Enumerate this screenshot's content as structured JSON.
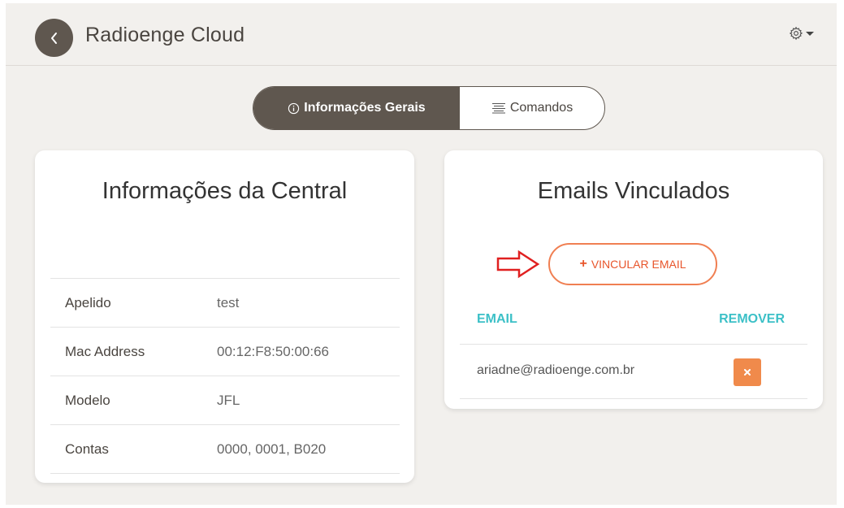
{
  "header": {
    "title": "Radioenge Cloud",
    "back_icon": "chevron-left-icon",
    "settings_icon": "gear-icon"
  },
  "tabs": [
    {
      "label": "Informações Gerais",
      "icon": "info-icon",
      "active": true
    },
    {
      "label": "Comandos",
      "icon": "list-icon",
      "active": false
    }
  ],
  "info_card": {
    "title": "Informações da Central",
    "rows": [
      {
        "label": "Apelido",
        "value": "test"
      },
      {
        "label": "Mac Address",
        "value": "00:12:F8:50:00:66"
      },
      {
        "label": "Modelo",
        "value": "JFL"
      },
      {
        "label": "Contas",
        "value": "0000, 0001, B020"
      }
    ]
  },
  "emails_card": {
    "title": "Emails Vinculados",
    "link_button_label": "VINCULAR EMAIL",
    "columns": {
      "email": "EMAIL",
      "remove": "REMOVER"
    },
    "emails": [
      {
        "email": "ariadne@radioenge.com.br"
      }
    ]
  },
  "colors": {
    "brand_dark": "#5f574f",
    "accent_orange": "#f07f52",
    "accent_teal": "#3cc0c7",
    "arrow_red": "#e02020"
  }
}
